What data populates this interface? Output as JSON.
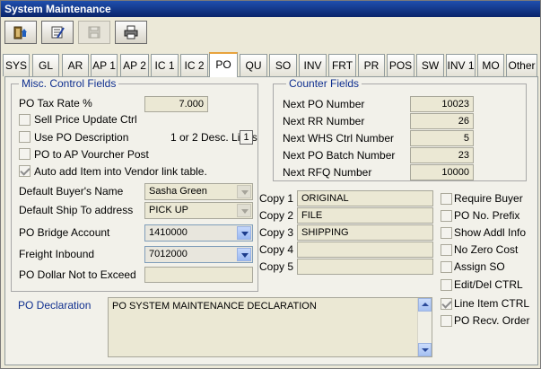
{
  "window": {
    "title": "System Maintenance"
  },
  "toolbar": {
    "buttons": [
      {
        "icon": "add-record-icon"
      },
      {
        "icon": "edit-record-icon"
      },
      {
        "icon": "save-disk-icon"
      },
      {
        "icon": "printer-icon"
      }
    ]
  },
  "tabs": [
    "SYS",
    "GL",
    "AR",
    "AP 1",
    "AP 2",
    "IC 1",
    "IC 2",
    "PO",
    "QU",
    "SO",
    "INV",
    "FRT",
    "PR",
    "POS",
    "SW",
    "INV 1",
    "MO",
    "Other"
  ],
  "active_tab": "PO",
  "misc": {
    "legend": "Misc. Control Fields",
    "tax_rate_label": "PO Tax Rate %",
    "tax_rate_value": "7.000",
    "sell_price_label": "Sell Price Update Ctrl",
    "use_desc_label": "Use PO Description",
    "desc_lines_label": "1 or 2 Desc. Lines",
    "desc_lines_value": "1",
    "po_to_ap_label": "PO to AP Vourcher Post",
    "auto_add_label": "Auto add Item into Vendor link table.",
    "buyer_label": "Default Buyer's Name",
    "buyer_value": "Sasha Green",
    "ship_to_label": "Default Ship To address",
    "ship_to_value": "PICK UP",
    "bridge_label": "PO Bridge Account",
    "bridge_value": "1410000",
    "freight_label": "Freight Inbound",
    "freight_value": "7012000",
    "dollar_label": "PO Dollar Not to Exceed",
    "dollar_value": ""
  },
  "counter": {
    "legend": "Counter Fields",
    "rows": [
      {
        "label": "Next PO Number",
        "value": "10023"
      },
      {
        "label": "Next RR Number",
        "value": "26"
      },
      {
        "label": "Next WHS Ctrl Number",
        "value": "5"
      },
      {
        "label": "Next PO Batch Number",
        "value": "23"
      },
      {
        "label": "Next RFQ Number",
        "value": "10000"
      }
    ]
  },
  "copies": [
    {
      "label": "Copy 1",
      "value": "ORIGINAL"
    },
    {
      "label": "Copy 2",
      "value": "FILE"
    },
    {
      "label": "Copy 3",
      "value": "SHIPPING"
    },
    {
      "label": "Copy 4",
      "value": ""
    },
    {
      "label": "Copy 5",
      "value": ""
    }
  ],
  "options": [
    {
      "label": "Require Buyer",
      "checked": false
    },
    {
      "label": "PO No. Prefix",
      "checked": false
    },
    {
      "label": "Show Addl Info",
      "checked": false
    },
    {
      "label": "No Zero Cost",
      "checked": false
    },
    {
      "label": "Assign SO",
      "checked": false
    },
    {
      "label": "Edit/Del CTRL",
      "checked": false
    },
    {
      "label": "Line Item CTRL",
      "checked": true
    },
    {
      "label": "PO Recv. Order",
      "checked": false
    }
  ],
  "declaration": {
    "label": "PO Declaration",
    "text": "PO SYSTEM MAINTENANCE DECLARATION"
  }
}
